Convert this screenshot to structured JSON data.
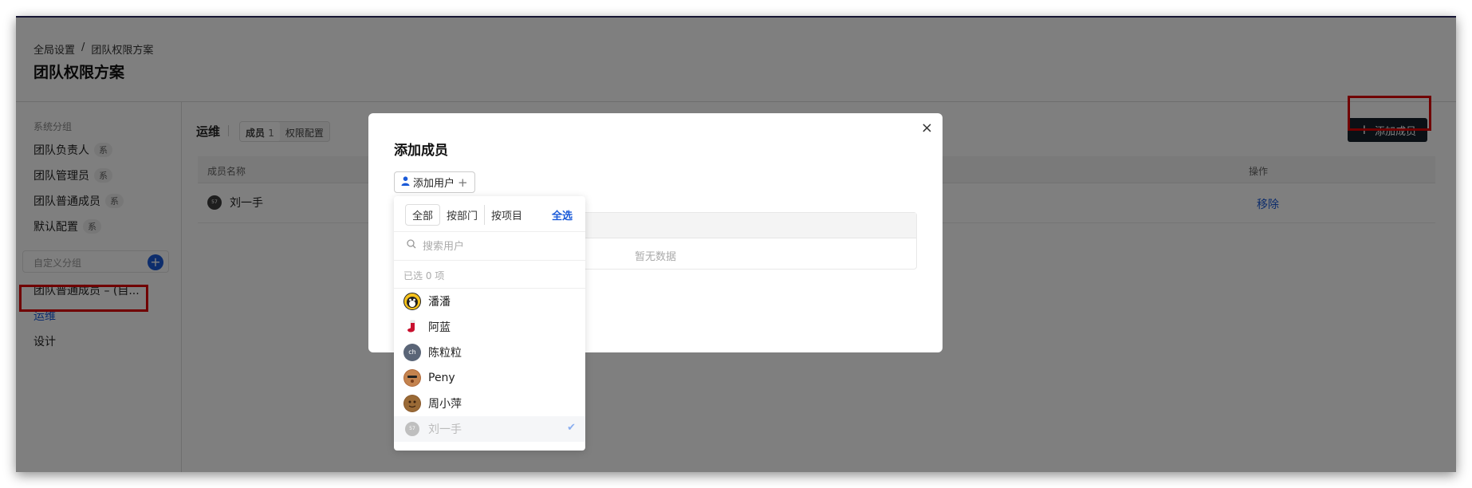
{
  "breadcrumb": [
    "全局设置",
    "/",
    "团队权限方案"
  ],
  "page_title": "团队权限方案",
  "sidebar": {
    "system_group_label": "系统分组",
    "system_items": [
      {
        "label": "团队负责人",
        "tag": "系"
      },
      {
        "label": "团队管理员",
        "tag": "系"
      },
      {
        "label": "团队普通成员",
        "tag": "系"
      },
      {
        "label": "默认配置",
        "tag": "系"
      }
    ],
    "custom_group_label": "自定义分组",
    "add_icon": "+",
    "custom_items": [
      "团队普通成员 – (自...",
      "运维",
      "设计"
    ]
  },
  "main": {
    "title": "运维",
    "tab_members_label": "成员",
    "tab_members_count": "1",
    "tab_permissions_label": "权限配置",
    "add_member_button": "添加成员",
    "add_member_icon": "+",
    "table": {
      "col_name": "成员名称",
      "col_action": "操作",
      "rows": [
        {
          "avatar_text": "57",
          "name": "刘一手",
          "action": "移除"
        }
      ]
    }
  },
  "modal": {
    "title": "添加成员",
    "close_icon": "×",
    "add_user_button": "添加用户",
    "no_data": "暂无数据"
  },
  "dropdown": {
    "tabs": [
      "全部",
      "按部门",
      "按项目"
    ],
    "select_all": "全选",
    "search_placeholder": "搜索用户",
    "selected_count": "已选 0 项",
    "users": [
      {
        "name": "潘潘",
        "avatar_color": "#f6c21c",
        "avatar_text": ""
      },
      {
        "name": "阿蓝",
        "avatar_color": "#ffffff",
        "avatar_text": ""
      },
      {
        "name": "陈粒粒",
        "avatar_color": "#5a6577",
        "avatar_text": "ch"
      },
      {
        "name": "Peny",
        "avatar_color": "#b06a3b",
        "avatar_text": ""
      },
      {
        "name": "周小萍",
        "avatar_color": "#8a5a2c",
        "avatar_text": ""
      },
      {
        "name": "刘一手",
        "avatar_color": "#bfbfbf",
        "avatar_text": "57",
        "selected": true
      }
    ]
  },
  "colors": {
    "accent": "#1a5ad8",
    "highlight_box": "#e00000",
    "dark_button": "#16202b"
  }
}
